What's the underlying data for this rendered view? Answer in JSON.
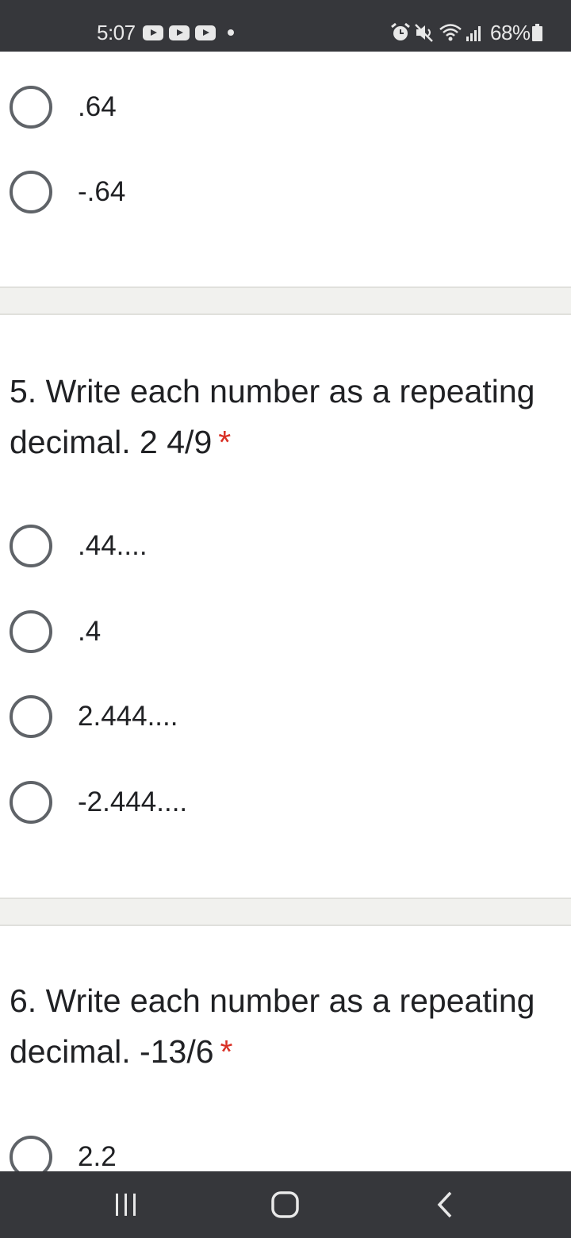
{
  "status_bar": {
    "time": "5:07",
    "notification_icons": [
      "youtube-icon",
      "youtube-icon",
      "youtube-icon",
      "more-dot-icon"
    ],
    "right_icons": [
      "alarm-icon",
      "mute-icon",
      "wifi-icon",
      "signal-icon"
    ],
    "battery": "68%"
  },
  "question4": {
    "options": [
      ".64",
      "-.64"
    ]
  },
  "question5": {
    "title": "5. Write each number as a repeating decimal. 2 4/9",
    "title_line1": "5. Write each number as a repeating",
    "title_line2": "decimal. 2 4/9",
    "required_mark": "*",
    "options": [
      ".44....",
      ".4",
      "2.444....",
      "-2.444...."
    ]
  },
  "question6": {
    "title": "6. Write each number as a repeating decimal. -13/6",
    "title_line1": "6. Write each number as a repeating",
    "title_line2": "decimal. -13/6",
    "required_mark": "*",
    "options": [
      "2.2"
    ]
  },
  "nav_bar": {
    "buttons": [
      "recent-apps-icon",
      "home-icon",
      "back-icon"
    ]
  },
  "colors": {
    "system_bar": "#36373b",
    "radio_border": "#5f6368",
    "required": "#d93025",
    "separator": "#f1f1ee"
  }
}
